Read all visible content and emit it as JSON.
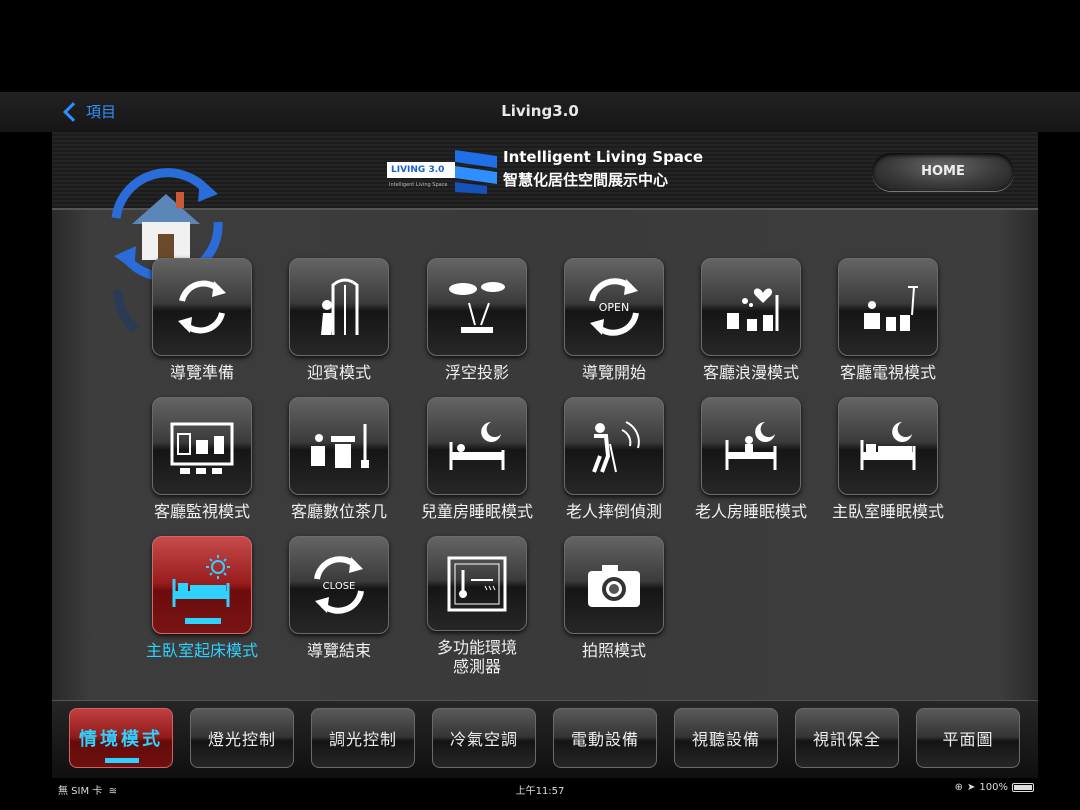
{
  "nav": {
    "back_label": "項目",
    "title": "Living3.0"
  },
  "brand": {
    "badge": "LIVING 3.0",
    "badge_sub": "Intelligent Living Space",
    "title_en": "Intelligent Living Space",
    "title_zh": "智慧化居住空間展示中心"
  },
  "header": {
    "home_label": "HOME"
  },
  "scenes": [
    {
      "label": "導覽準備",
      "icon": "cycle-arrows-icon"
    },
    {
      "label": "迎賓模式",
      "icon": "greeting-door-icon"
    },
    {
      "label": "浮空投影",
      "icon": "floating-projection-icon"
    },
    {
      "label": "導覽開始",
      "icon": "open-cycle-icon",
      "icon_text": "OPEN"
    },
    {
      "label": "客廳浪漫模式",
      "icon": "romance-heart-icon"
    },
    {
      "label": "客廳電視模式",
      "icon": "tv-lamp-icon"
    },
    {
      "label": "客廳監視模式",
      "icon": "surveillance-screen-icon"
    },
    {
      "label": "客廳數位茶几",
      "icon": "digital-table-icon"
    },
    {
      "label": "兒童房睡眠模式",
      "icon": "child-sleep-moon-icon"
    },
    {
      "label": "老人摔倒偵測",
      "icon": "elder-fall-detect-icon"
    },
    {
      "label": "老人房睡眠模式",
      "icon": "elder-sleep-moon-icon"
    },
    {
      "label": "主臥室睡眠模式",
      "icon": "bed-sleep-moon-icon"
    },
    {
      "label": "主臥室起床模式",
      "icon": "bed-wakeup-sun-icon",
      "active": true
    },
    {
      "label": "導覽結束",
      "icon": "close-cycle-icon",
      "icon_text": "CLOSE"
    },
    {
      "label": "多功能環境\n感測器",
      "label_line1": "多功能環境",
      "label_line2": "感測器",
      "icon": "env-sensor-icon"
    },
    {
      "label": "拍照模式",
      "icon": "camera-icon"
    }
  ],
  "tabs": [
    {
      "label": "情境模式",
      "active": true
    },
    {
      "label": "燈光控制"
    },
    {
      "label": "調光控制"
    },
    {
      "label": "冷氣空調"
    },
    {
      "label": "電動設備"
    },
    {
      "label": "視聽設備"
    },
    {
      "label": "視訊保全"
    },
    {
      "label": "平面圖"
    }
  ],
  "status": {
    "carrier": "無 SIM 卡",
    "time": "上午11:57",
    "battery": "100%",
    "battery_level": 1.0
  },
  "colors": {
    "accent_cyan": "#2fd1ff",
    "active_red": "#9a1d1d",
    "ios_blue": "#2f8fff"
  }
}
